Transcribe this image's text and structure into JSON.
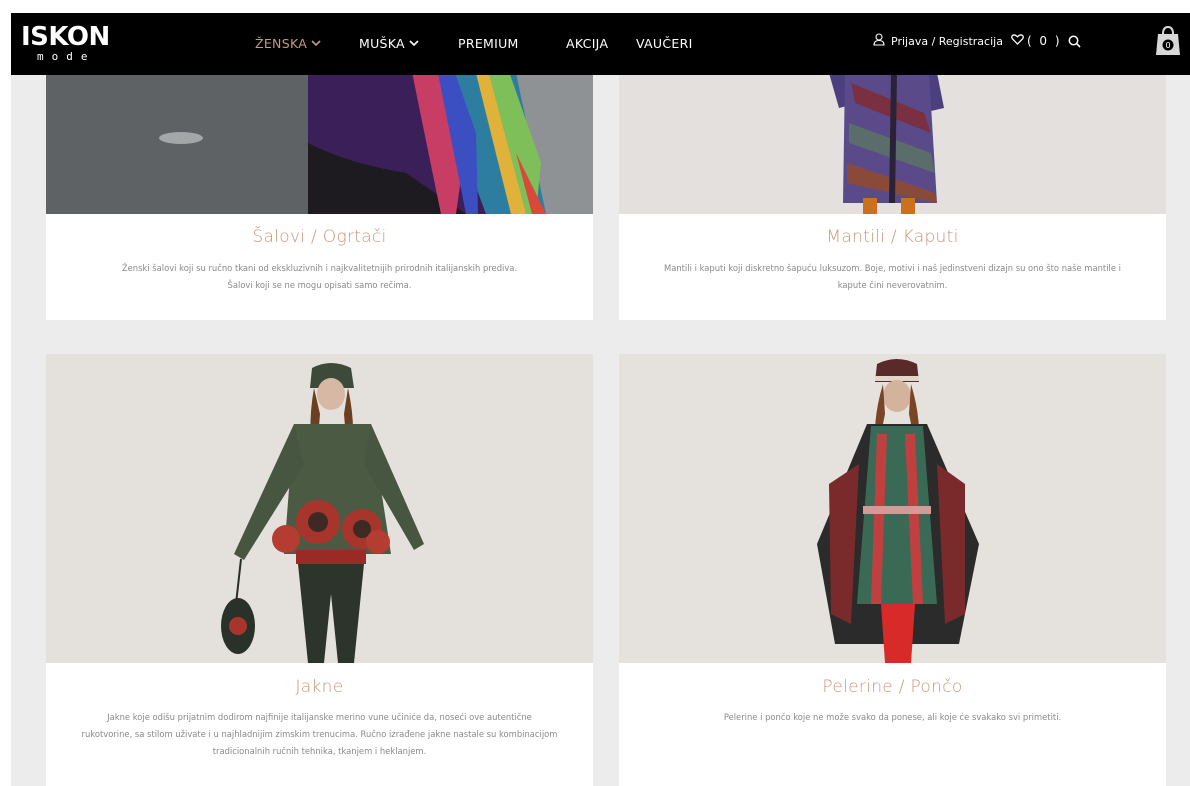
{
  "brand": {
    "name": "ISKON",
    "sub": "mode"
  },
  "nav": [
    {
      "label": "ŽENSKA",
      "dropdown": true,
      "active": true
    },
    {
      "label": "MUŠKA",
      "dropdown": true,
      "active": false
    },
    {
      "label": "PREMIUM",
      "dropdown": false,
      "active": false
    },
    {
      "label": "AKCIJA",
      "dropdown": false,
      "active": false
    },
    {
      "label": "VAUČERI",
      "dropdown": false,
      "active": false
    }
  ],
  "header": {
    "login_label": "Prijava / Registracija",
    "wishlist_count": "( 0 )",
    "cart_count": "0"
  },
  "colors": {
    "accent": "#c79a78",
    "title": "#c9967a",
    "header_bg": "#000000",
    "page_bg": "#ececec"
  },
  "categories": [
    {
      "title": "Šalovi / Ogrtači",
      "desc_lines": [
        "Ženski šalovi koji su ručno tkani od ekskluzivnih i najkvalitetnijih prirodnih italijanskih prediva.",
        "Šalovi koji se ne mogu opisati samo rečima."
      ]
    },
    {
      "title": "Mantili / Kaputi",
      "desc_lines": [
        "Mantili i kaputi koji diskretno šapuću luksuzom. Boje, motivi i naš jedinstveni dizajn su ono što naše mantile i",
        "kapute čini neverovatnim."
      ]
    },
    {
      "title": "Jakne",
      "desc_lines": [
        "Jakne koje odišu prijatnim dodirom najfinije italijanske merino vune učiniće da, noseći ove autentične",
        "rukotvorine, sa stilom uživate i u najhladnijim zimskim trenucima. Ručno izrađene jakne nastale su kombinacijom",
        "tradicionalnih ručnih tehnika, tkanjem i heklanjem."
      ]
    },
    {
      "title": "Pelerine / Pončo",
      "desc_lines": [
        "Pelerine i pončo koje ne može svako da ponese, ali koje će svakako svi primetiti."
      ]
    }
  ]
}
